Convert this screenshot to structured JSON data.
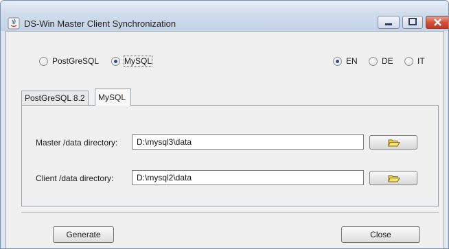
{
  "window": {
    "title": "DS-Win Master Client Synchronization"
  },
  "db_choice": {
    "options": [
      {
        "label": "PostGreSQL",
        "checked": false
      },
      {
        "label": "MySQL",
        "checked": true
      }
    ]
  },
  "language": {
    "options": [
      {
        "label": "EN",
        "checked": true
      },
      {
        "label": "DE",
        "checked": false
      },
      {
        "label": "IT",
        "checked": false
      }
    ]
  },
  "tabs": [
    {
      "label": "PostGreSQL 8.2",
      "active": false
    },
    {
      "label": "MySQL",
      "active": true
    }
  ],
  "fields": {
    "master_label": "Master /data directory:",
    "master_value": "D:\\mysql3\\data",
    "client_label": "Client /data directory:",
    "client_value": "D:\\mysql2\\data"
  },
  "buttons": {
    "generate": "Generate",
    "close": "Close"
  },
  "colors": {
    "folder_icon": "#e8d24a",
    "radio_dot": "#2a4e8c",
    "close_button": "#c0391f"
  }
}
